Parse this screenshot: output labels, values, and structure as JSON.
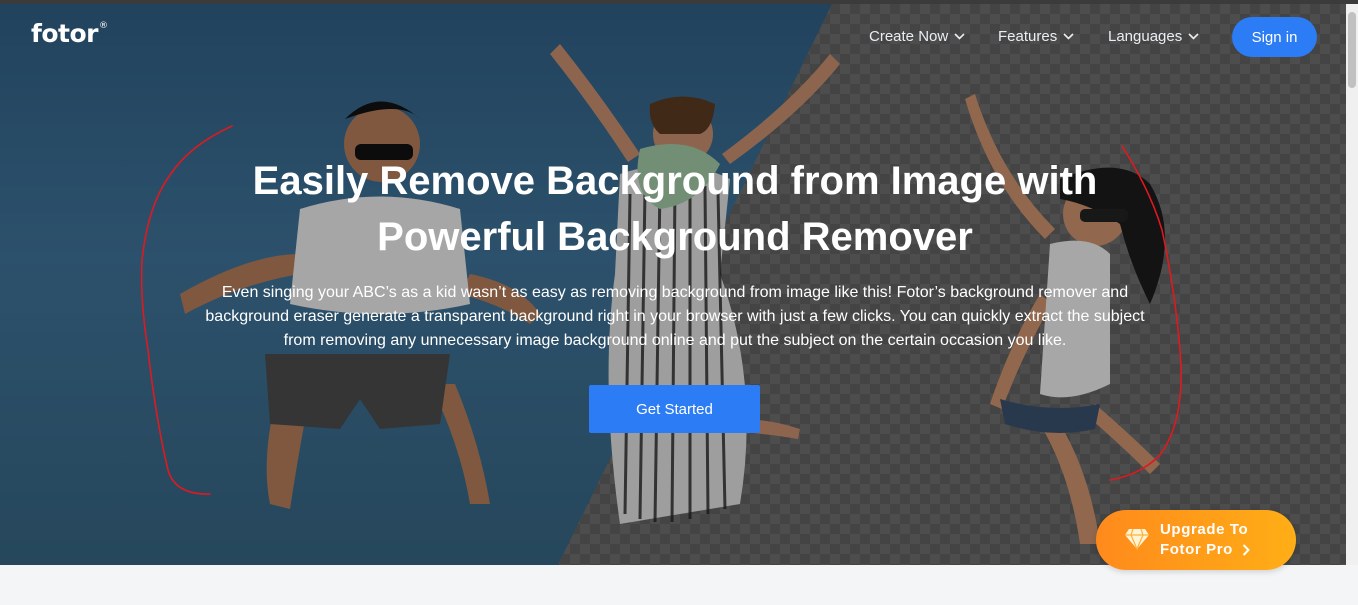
{
  "brand": {
    "logo_text": "fotor",
    "logo_mark": "®"
  },
  "nav": {
    "create_now": "Create Now",
    "features": "Features",
    "languages": "Languages",
    "sign_in": "Sign in"
  },
  "hero": {
    "headline": "Easily Remove Background from Image with Powerful Background Remover",
    "description": "Even singing your ABC’s as a kid wasn’t as easy as removing background from image like this! Fotor’s background remover and background eraser generate a transparent background right in your browser with just a few clicks. You can quickly extract the subject from removing any unnecessary image background online and put the subject on the certain occasion you like.",
    "cta": "Get Started"
  },
  "promo": {
    "line1": "Upgrade To",
    "line2": "Fotor Pro",
    "icon": "diamond-icon"
  },
  "colors": {
    "primary": "#2b7cf5",
    "promo_start": "#ff8a1c",
    "promo_end": "#ffae16",
    "annotation": "#e0191f"
  }
}
